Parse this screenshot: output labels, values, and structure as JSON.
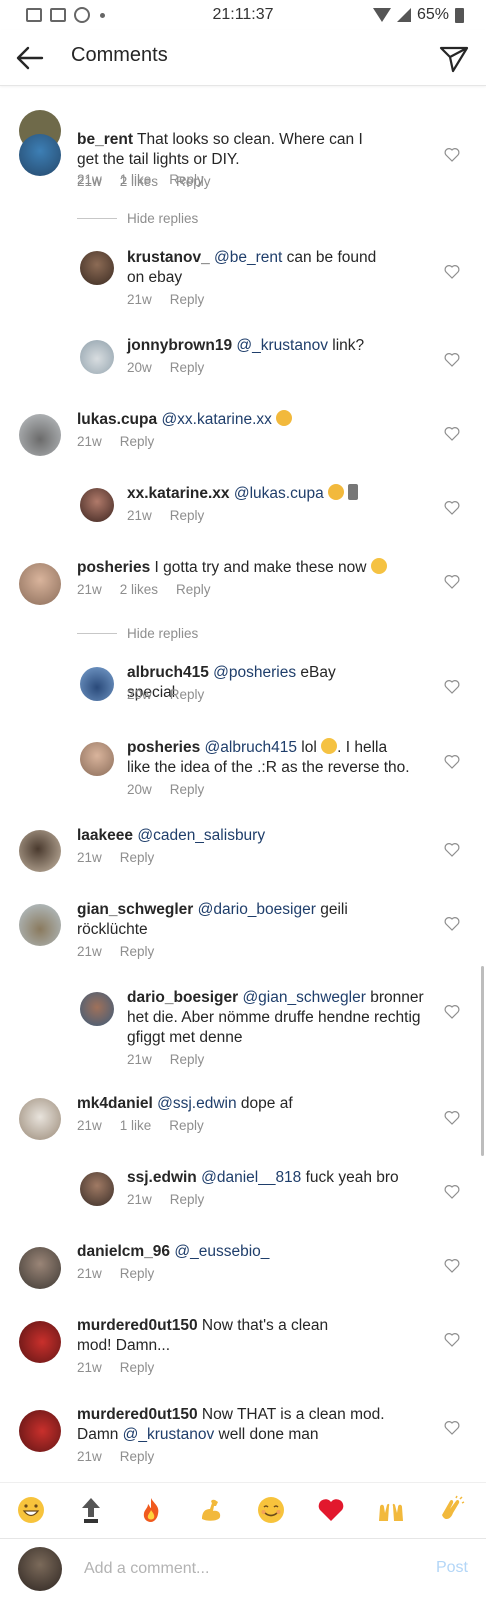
{
  "status_bar": {
    "time": "21:11:37",
    "battery": "65%"
  },
  "header": {
    "title": "Comments"
  },
  "comments": [
    {
      "user": "",
      "text": "",
      "time": "21w",
      "likes": "1 like",
      "reply": "Reply"
    },
    {
      "user": "be_rent",
      "text": " That looks so clean. Where can I get the tail lights or DIY.",
      "time": "21w",
      "likes": "2 likes",
      "reply": "Reply",
      "hide_replies": "Hide replies"
    },
    {
      "user": "krustanov_",
      "mention": "@be_rent",
      "text": " can be found on ebay",
      "time": "21w",
      "reply": "Reply"
    },
    {
      "user": "jonnybrown19",
      "mention": "@_krustanov",
      "text": " link?",
      "time": "20w",
      "reply": "Reply"
    },
    {
      "user": "lukas.cupa",
      "mention": "@xx.katarine.xx",
      "text": "",
      "time": "21w",
      "reply": "Reply"
    },
    {
      "user": "xx.katarine.xx",
      "mention": "@lukas.cupa",
      "text": "",
      "time": "21w",
      "reply": "Reply"
    },
    {
      "user": "posheries",
      "text": " I gotta try and make these now",
      "time": "21w",
      "likes": "2 likes",
      "reply": "Reply",
      "hide_replies": "Hide replies"
    },
    {
      "user": "albruch415",
      "mention": "@posheries",
      "text": " eBay special",
      "time": "20w",
      "reply": "Reply"
    },
    {
      "user": "posheries",
      "mention": "@albruch415",
      "text_a": " lol ",
      "text_b": ". I hella like the idea of the .:R as the reverse tho.",
      "time": "20w",
      "reply": "Reply"
    },
    {
      "user": "laakeee",
      "mention": "@caden_salisbury",
      "text": "",
      "time": "21w",
      "reply": "Reply"
    },
    {
      "user": "gian_schwegler",
      "mention": "@dario_boesiger",
      "text": "  geili röcklüchte",
      "time": "21w",
      "reply": "Reply"
    },
    {
      "user": "dario_boesiger",
      "mention": "@gian_schwegler",
      "text": " bronner het die. Aber nömme druffe hendne rechtig gfiggt met denne",
      "time": "21w",
      "reply": "Reply"
    },
    {
      "user": "mk4daniel",
      "mention": "@ssj.edwin",
      "text": " dope af",
      "time": "21w",
      "likes": "1 like",
      "reply": "Reply"
    },
    {
      "user": "ssj.edwin",
      "mention": "@daniel__818",
      "text": " fuck yeah bro",
      "time": "21w",
      "reply": "Reply"
    },
    {
      "user": "danielcm_96",
      "mention": "@_eussebio_",
      "text": "",
      "time": "21w",
      "reply": "Reply"
    },
    {
      "user": "murdered0ut150",
      "text": " Now that's a clean mod! Damn...",
      "time": "21w",
      "reply": "Reply"
    },
    {
      "user": "murdered0ut150",
      "text_a": " Now THAT is a clean mod. Damn ",
      "mention": "@_krustanov",
      "text_b": " well done man",
      "time": "21w",
      "reply": "Reply"
    }
  ],
  "emoji_bar": [
    "grin-emoji",
    "top-emoji",
    "fire-emoji",
    "muscle-emoji",
    "smile-emoji",
    "heart-emoji",
    "raised-hands-emoji",
    "clap-emoji"
  ],
  "input": {
    "placeholder": "Add a comment...",
    "post_label": "Post"
  },
  "colors": {
    "mention": "#1f3e6b",
    "meta": "#8e8e8e",
    "post": "#b3d6f7"
  }
}
